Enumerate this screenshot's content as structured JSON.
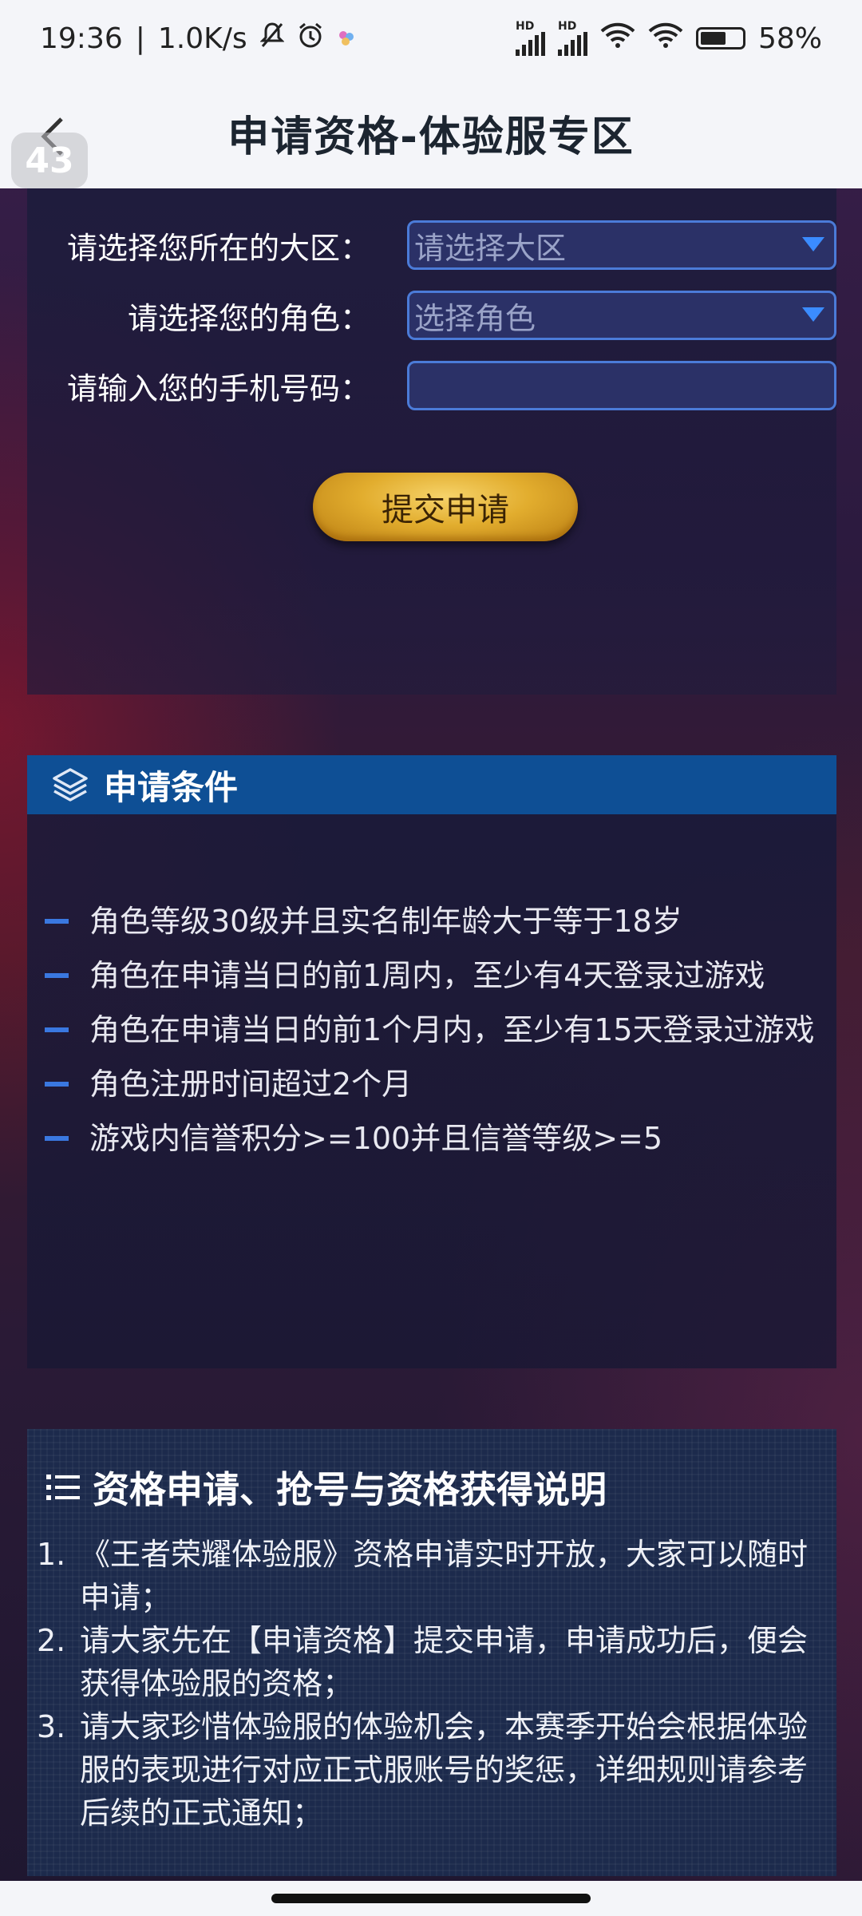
{
  "status_bar": {
    "time": "19:36",
    "speed": "1.0K/s",
    "battery": "58%",
    "hd1": "HD",
    "hd2": "HD"
  },
  "header": {
    "title": "申请资格-体验服专区",
    "badge": "43"
  },
  "form": {
    "rows": [
      {
        "label": "请选择您所在的大区：",
        "value": "请选择大区"
      },
      {
        "label": "请选择您的角色：",
        "value": "选择角色"
      },
      {
        "label": "请输入您的手机号码：",
        "value": ""
      }
    ],
    "submit_label": "提交申请"
  },
  "conditions": {
    "title": "申请条件",
    "items": [
      "角色等级30级并且实名制年龄大于等于18岁",
      "角色在申请当日的前1周内，至少有4天登录过游戏",
      "角色在申请当日的前1个月内，至少有15天登录过游戏",
      "角色注册时间超过2个月",
      "游戏内信誉积分>=100并且信誉等级>=5"
    ]
  },
  "info": {
    "title": "资格申请、抢号与资格获得说明",
    "items": [
      {
        "num": "1.",
        "text": "《王者荣耀体验服》资格申请实时开放，大家可以随时申请；"
      },
      {
        "num": "2.",
        "text": "请大家先在【申请资格】提交申请，申请成功后，便会获得体验服的资格；"
      },
      {
        "num": "3.",
        "text": "请大家珍惜体验服的体验机会，本赛季开始会根据体验服的表现进行对应正式服账号的奖惩，详细规则请参考后续的正式通知；"
      }
    ]
  },
  "colors": {
    "accent_blue": "#0e4f95",
    "dash_blue": "#3a78e0",
    "button_gold": "#e2ad2e"
  }
}
